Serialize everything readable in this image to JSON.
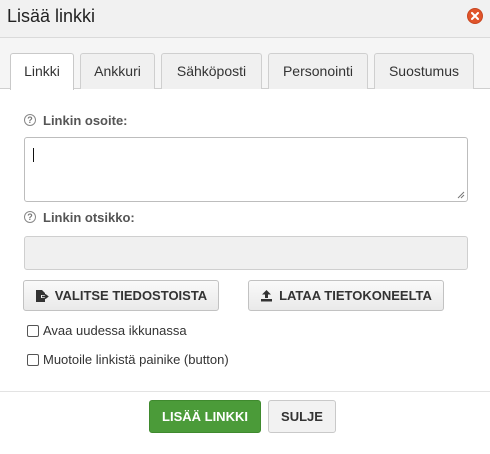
{
  "dialog": {
    "title": "Lisää linkki",
    "close_icon": "close-icon"
  },
  "tabs": [
    {
      "label": "Linkki",
      "active": true
    },
    {
      "label": "Ankkuri",
      "active": false
    },
    {
      "label": "Sähköposti",
      "active": false
    },
    {
      "label": "Personointi",
      "active": false
    },
    {
      "label": "Suostumus",
      "active": false
    }
  ],
  "form": {
    "url_label": "Linkin osoite:",
    "url_value": "",
    "title_label": "Linkin otsikko:",
    "title_value": "",
    "help_icon": "question-circle-icon"
  },
  "actions": {
    "choose_files_label": "VALITSE TIEDOSTOISTA",
    "choose_files_icon": "file-export-icon",
    "upload_label": "LATAA TIETOKONEELTA",
    "upload_icon": "upload-icon"
  },
  "options": {
    "new_window_label": "Avaa uudessa ikkunassa",
    "new_window_checked": false,
    "as_button_label": "Muotoile linkistä painike (button)",
    "as_button_checked": false
  },
  "footer": {
    "add_label": "LISÄÄ LINKKI",
    "close_label": "SULJE"
  },
  "colors": {
    "primary": "#4b9b39",
    "close": "#e0542a"
  }
}
